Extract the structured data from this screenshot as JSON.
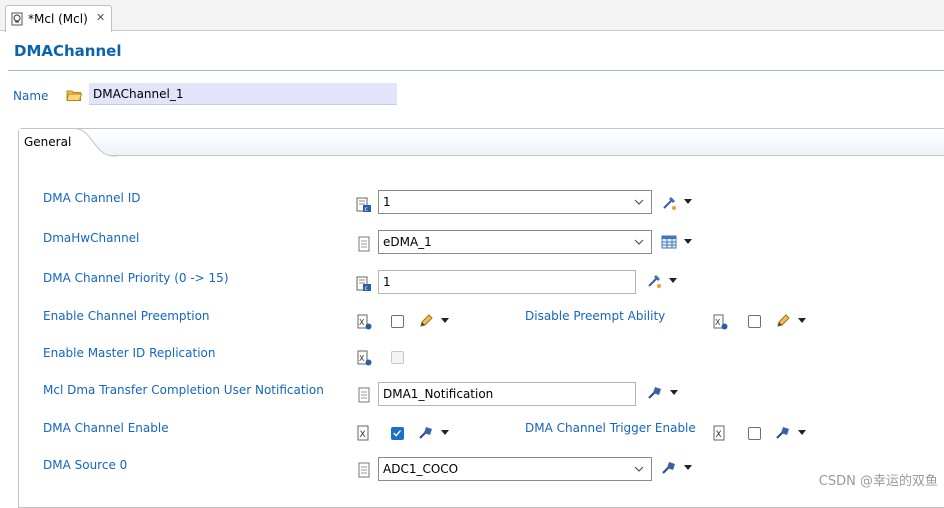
{
  "editor_tab": {
    "label": "*Mcl (Mcl)",
    "close_glyph": "✕"
  },
  "page": {
    "title": "DMAChannel"
  },
  "name_field": {
    "label": "Name",
    "value": "DMAChannel_1"
  },
  "section": {
    "label": "General"
  },
  "fields": {
    "channel_id": {
      "label": "DMA Channel ID",
      "value": "1"
    },
    "hw_channel": {
      "label": "DmaHwChannel",
      "value": "eDMA_1"
    },
    "priority": {
      "label": "DMA Channel Priority (0 -> 15)",
      "value": "1"
    },
    "preemption": {
      "label": "Enable Channel Preemption",
      "checked": false
    },
    "disable_preempt": {
      "label": "Disable Preempt Ability",
      "checked": false
    },
    "master_id": {
      "label": "Enable Master ID Replication",
      "checked": false,
      "enabled": false
    },
    "notification": {
      "label": "Mcl Dma Transfer Completion User Notification",
      "value": "DMA1_Notification"
    },
    "channel_enable": {
      "label": "DMA Channel Enable",
      "checked": true
    },
    "trigger_enable": {
      "label": "DMA Channel Trigger Enable",
      "checked": false
    },
    "source": {
      "label": "DMA Source 0",
      "value": "ADC1_COCO"
    }
  },
  "icons": {
    "tab": "editor-file-icon",
    "name": "open-folder-icon",
    "calc": "calculator-config-icon",
    "doc": "document-config-icon",
    "pencil": "edit-pencil-icon",
    "wand": "wand-icon",
    "table": "table-select-icon",
    "dropdown": "chevron-down-icon"
  },
  "colors": {
    "label_blue": "#1565c0",
    "title_blue": "#0a64ad",
    "name_bg": "#e3e3f9",
    "check_blue": "#1e6fc8"
  },
  "watermark": "CSDN @幸运的双鱼"
}
